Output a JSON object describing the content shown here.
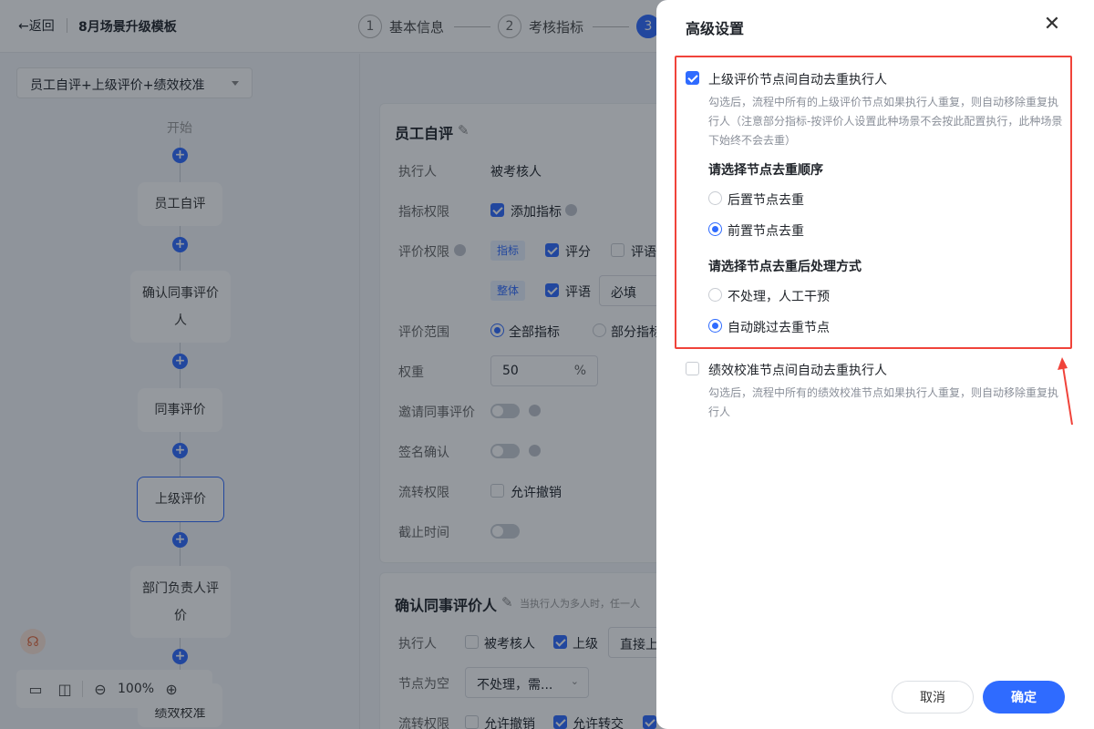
{
  "header": {
    "back_label": "←返回",
    "title": "8月场景升级模板",
    "steps": [
      {
        "num": "1",
        "label": "基本信息"
      },
      {
        "num": "2",
        "label": "考核指标"
      },
      {
        "num": "3",
        "label": ""
      }
    ]
  },
  "left": {
    "flow_select": "员工自评+上级评价+绩效校准",
    "start_label": "开始",
    "nodes": [
      "员工自评",
      "确认同事评价人",
      "同事评价",
      "上级评价",
      "部门负责人评价",
      "绩效校准"
    ],
    "zoom": "100%"
  },
  "main": {
    "card1": {
      "title": "员工自评",
      "executor_label": "执行人",
      "executor_value": "被考核人",
      "index_perm_label": "指标权限",
      "add_index": "添加指标",
      "eval_perm_label": "评价权限",
      "tag_index": "指标",
      "score": "评分",
      "comment": "评语",
      "tag_whole": "整体",
      "comment2": "评语",
      "required": "必填",
      "range_label": "评价范围",
      "all_index": "全部指标",
      "part_index": "部分指标",
      "weight_label": "权重",
      "weight_value": "50",
      "weight_unit": "%",
      "invite_label": "邀请同事评价",
      "sign_label": "签名确认",
      "flow_perm_label": "流转权限",
      "allow_revoke": "允许撤销",
      "deadline_label": "截止时间"
    },
    "card2": {
      "title": "确认同事评价人",
      "hint": "当执行人为多人时，任一人",
      "executor_label": "执行人",
      "opt_assessee": "被考核人",
      "opt_superior": "上级",
      "superior_select": "直接上",
      "empty_label": "节点为空",
      "empty_select": "不处理，需...",
      "flow_perm_label": "流转权限",
      "allow_revoke": "允许撤销",
      "allow_transfer": "允许转交"
    }
  },
  "drawer": {
    "title": "高级设置",
    "opt1_label": "上级评价节点间自动去重执行人",
    "opt1_checked": true,
    "opt1_desc": "勾选后，流程中所有的上级评价节点如果执行人重复，则自动移除重复执行人（注意部分指标-按评价人设置此种场景不会按此配置执行，此种场景下始终不会去重）",
    "order_head": "请选择节点去重顺序",
    "order_opt1": "后置节点去重",
    "order_opt2": "前置节点去重",
    "order_selected": 2,
    "handle_head": "请选择节点去重后处理方式",
    "handle_opt1": "不处理，人工干预",
    "handle_opt2": "自动跳过去重节点",
    "handle_selected": 2,
    "opt2_label": "绩效校准节点间自动去重执行人",
    "opt2_checked": false,
    "opt2_desc": "勾选后，流程中所有的绩效校准节点如果执行人重复，则自动移除重复执行人",
    "cancel": "取消",
    "confirm": "确定"
  },
  "colors": {
    "accent": "#2f6bff",
    "highlight": "#f0433a"
  }
}
